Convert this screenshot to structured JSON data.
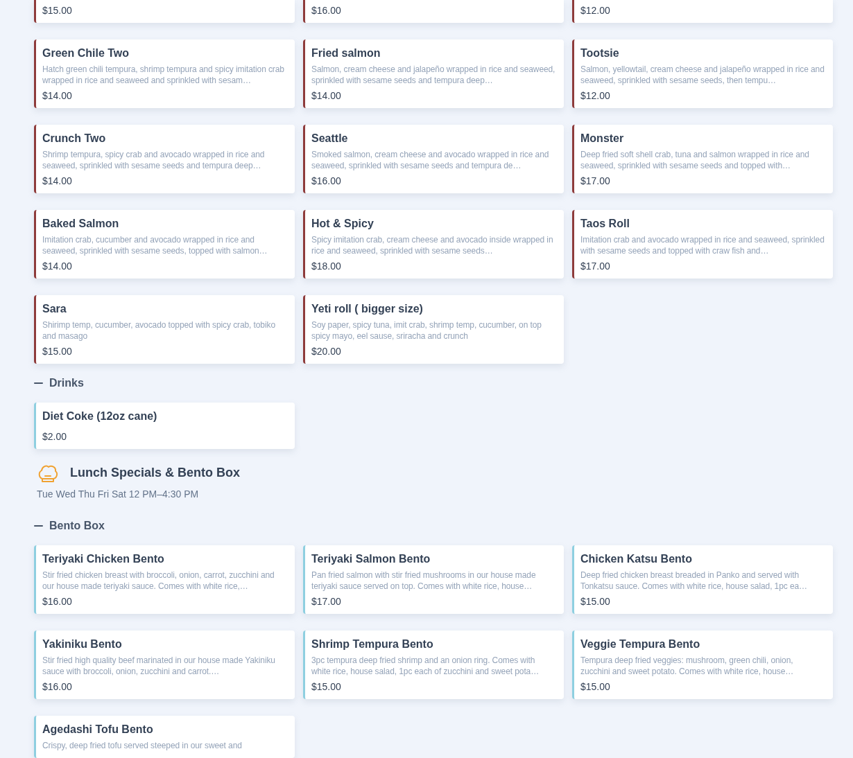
{
  "blocks": [
    {
      "kind": "group",
      "color": "#8e3b3b",
      "items": [
        {
          "price": "$15.00"
        },
        {
          "price": "$16.00"
        },
        {
          "price": "$12.00"
        },
        {
          "name": "Green Chile Two",
          "description": "Hatch green chili tempura, shrimp tempura and spicy imitation crab wrapped in rice and seaweed and sprinkled with sesam…",
          "price": "$14.00"
        },
        {
          "name": "Fried salmon",
          "description": "Salmon, cream cheese and jalapeño wrapped in rice and seaweed, sprinkled with sesame seeds and tempura deep…",
          "price": "$14.00"
        },
        {
          "name": "Tootsie",
          "description": "Salmon, yellowtail, cream cheese and jalapeño wrapped in rice and seaweed, sprinkled with sesame seeds, then tempu…",
          "price": "$12.00"
        },
        {
          "name": "Crunch Two",
          "description": "Shrimp tempura, spicy crab and avocado wrapped in rice and seaweed, sprinkled with sesame seeds and tempura deep…",
          "price": "$14.00"
        },
        {
          "name": "Seattle",
          "description": "Smoked salmon, cream cheese and avocado wrapped in rice and seaweed, sprinkled with sesame seeds and tempura de…",
          "price": "$16.00"
        },
        {
          "name": "Monster",
          "description": "Deep fried soft shell crab, tuna and salmon wrapped in rice and seaweed, sprinkled with sesame seeds and topped with…",
          "price": "$17.00"
        },
        {
          "name": "Baked Salmon",
          "description": "Imitation crab, cucumber and avocado wrapped in rice and seaweed, sprinkled with sesame seeds, topped with salmon…",
          "price": "$14.00"
        },
        {
          "name": "Hot & Spicy",
          "description": "Spicy imitation crab, cream cheese and avocado inside wrapped in rice and seaweed, sprinkled with sesame seeds…",
          "price": "$18.00"
        },
        {
          "name": "Taos Roll",
          "description": "Imitation crab and avocado wrapped in rice and seaweed, sprinkled with sesame seeds and topped with craw fish and…",
          "price": "$17.00"
        },
        {
          "name": "Sara",
          "description": "Shirimp temp, cucumber, avocado topped with spicy crab, tobiko and masago",
          "price": "$15.00"
        },
        {
          "name": "Yeti roll ( bigger size)",
          "description": "Soy paper, spicy tuna, imit crab, shrimp temp, cucumber, on top spicy mayo, eel sause, sriracha and crunch",
          "price": "$20.00"
        }
      ]
    },
    {
      "kind": "group",
      "label": "Drinks",
      "expanded": true,
      "color": "#8ecfe0",
      "items": [
        {
          "name": "Diet Coke (12oz cane)",
          "price": "$2.00"
        }
      ]
    },
    {
      "kind": "menu",
      "title": "Lunch Specials & Bento Box",
      "hours": "Tue Wed Thu Fri Sat 12 PM–4:30 PM"
    },
    {
      "kind": "group",
      "label": "Bento Box",
      "expanded": true,
      "color": "#8ecfe0",
      "items": [
        {
          "name": "Teriyaki Chicken Bento",
          "description": "Stir fried chicken breast with broccoli, onion, carrot, zucchini and our house made teriyaki sauce. Comes with white rice,…",
          "price": "$16.00"
        },
        {
          "name": "Teriyaki Salmon Bento",
          "description": "Pan fried salmon with stir fried mushrooms in our house made teriyaki sauce served on top. Comes with white rice, house…",
          "price": "$17.00"
        },
        {
          "name": "Chicken Katsu Bento",
          "description": "Deep fried chicken breast breaded in Panko and served with Tonkatsu sauce. Comes with white rice, house salad, 1pc ea…",
          "price": "$15.00"
        },
        {
          "name": "Yakiniku Bento",
          "description": "Stir fried high quality beef marinated in our house made Yakiniku sauce with broccoli, onion, zucchini and carrot.…",
          "price": "$16.00"
        },
        {
          "name": "Shrimp Tempura Bento",
          "description": "3pc tempura deep fried shrimp and an onion ring. Comes with white rice, house salad, 1pc each of zucchini and sweet pota…",
          "price": "$15.00"
        },
        {
          "name": "Veggie Tempura Bento",
          "description": "Tempura deep fried veggies: mushroom, green chili, onion, zucchini and sweet potato. Comes with white rice, house…",
          "price": "$15.00"
        },
        {
          "name": "Agedashi Tofu Bento",
          "description": "Crispy, deep fried tofu served steeped in our sweet and"
        }
      ]
    }
  ]
}
